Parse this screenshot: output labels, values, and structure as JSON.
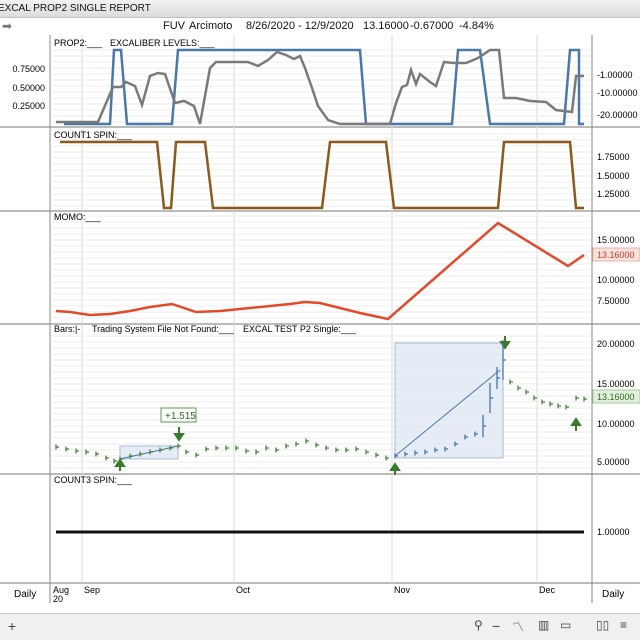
{
  "window": {
    "title": "EXCAL PROP2 SINGLE REPORT"
  },
  "header": {
    "symbol": "FUV",
    "name": "Arcimoto",
    "date_range": "8/26/2020 - 12/9/2020",
    "last": "13.16000",
    "change": "-0.67000",
    "change_pct": "-4.84%"
  },
  "panes": {
    "prop2": {
      "label": "PROP2:___",
      "label2": "EXCALIBER LEVELS:___",
      "left_ticks": [
        "0.75000",
        "0.50000",
        "0.25000"
      ],
      "right_ticks": [
        "-1.00000",
        "-10.00000",
        "-20.00000"
      ]
    },
    "count1": {
      "label": "COUNT1 SPIN:___",
      "right_ticks": [
        "1.75000",
        "1.50000",
        "1.25000"
      ]
    },
    "momo": {
      "label": "MOMO:___",
      "right_ticks": [
        "15.00000",
        "10.00000",
        "7.50000"
      ],
      "badge": "13.16000"
    },
    "bars": {
      "label": "Bars:|-",
      "label2": "Trading System File Not Found:___",
      "label3": "EXCAL TEST P2 Single:___",
      "right_ticks": [
        "20.00000",
        "15.00000",
        "10.00000",
        "5.00000"
      ],
      "badge": "13.16000",
      "annotation": "+1.515"
    },
    "count3": {
      "label": "COUNT3 SPIN:___",
      "right_ticks": [
        "1.00000"
      ]
    }
  },
  "x_axis": {
    "labels": [
      "Aug",
      "20",
      "Sep",
      "Oct",
      "Nov",
      "Dec"
    ]
  },
  "footer": {
    "left": "Daily",
    "right": "Daily"
  },
  "colors": {
    "blue": "#4a78a8",
    "gray": "#7a7a7a",
    "brown": "#8b5a1e",
    "red": "#e24a2a",
    "green": "#3a7a2a"
  },
  "icons": [
    "plus-icon",
    "search-icon",
    "zoom-out-icon",
    "zoom-in-icon",
    "line-chart-icon",
    "candlestick-icon",
    "panel-icon",
    "book-icon",
    "menu-icon"
  ]
}
